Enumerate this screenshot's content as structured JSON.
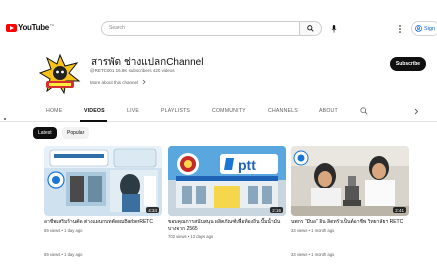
{
  "masthead": {
    "logo_text": "YouTube",
    "logo_sup": "TH",
    "search_placeholder": "Search",
    "signin_label": "Sign"
  },
  "channel": {
    "name": "สารพัด ช่างแปลกChannel",
    "handle": "@RETC001",
    "subscribers": "16.8K subscribers",
    "videos_count": "420 videos",
    "more_label": "More about this channel",
    "subscribe_label": "Subscribe"
  },
  "tabs": [
    {
      "label": "HOME"
    },
    {
      "label": "VIDEOS"
    },
    {
      "label": "LIVE"
    },
    {
      "label": "PLAYLISTS"
    },
    {
      "label": "COMMUNITY"
    },
    {
      "label": "CHANNELS"
    },
    {
      "label": "ABOUT"
    }
  ],
  "chips": [
    {
      "label": "Latest"
    },
    {
      "label": "Popular"
    }
  ],
  "videos": [
    {
      "title_line1": "อาชีพเสริมร้านตัด ต่างแผนกบทตัดผมBarberRETC",
      "title_line2": "",
      "meta": "59 views • 1 day ago",
      "duration": "4:34"
    },
    {
      "title_line1": "ขอบคุณการสนับสนุน ผลิตภัณฑ์เพื่อท้องถิ่น ปั๊มน้ำมันบางจาก 2565",
      "title_line2": "",
      "meta": "702 views • 13 days ago",
      "duration": "2:16"
    },
    {
      "title_line1": "นพกร \"มีบอ\" อิน ลิดทรัวเป็นต์อาชีพ วิทยาลัยฯ RETC",
      "title_line2": "",
      "meta": "33 views • 1 month ago",
      "duration": "2:41"
    }
  ],
  "ghost_row": [
    "59 views • 1 day ago",
    "33 views • 1 month ago"
  ],
  "colors": {
    "brand": "#ff0000",
    "text": "#0f0f0f",
    "muted": "#606060",
    "link": "#065fd4"
  }
}
